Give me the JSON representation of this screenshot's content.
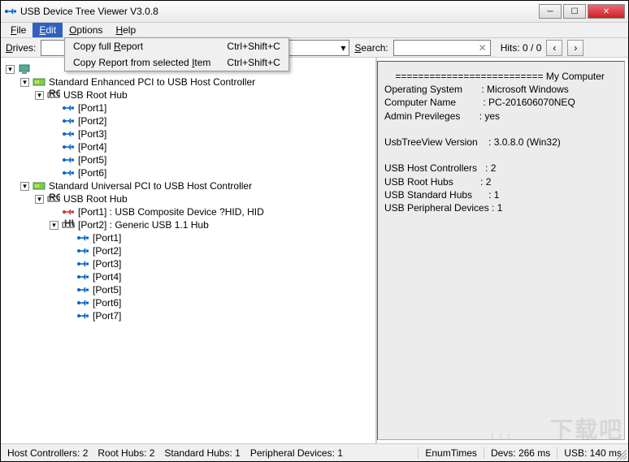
{
  "title": "USB Device Tree Viewer V3.0.8",
  "menubar": [
    "File",
    "Edit",
    "Options",
    "Help"
  ],
  "active_menu": "Edit",
  "dropdown": [
    {
      "label": "Copy full Report",
      "shortcut": "Ctrl+Shift+C",
      "u": "R"
    },
    {
      "label": "Copy Report from selected Item",
      "shortcut": "Ctrl+Shift+C",
      "u": "I"
    }
  ],
  "toolbar": {
    "drives_label": "Drives:",
    "search_label": "Search:",
    "hits_label": "Hits: 0 / 0"
  },
  "tree": [
    {
      "indent": 0,
      "expander": "-",
      "icon": "computer",
      "label": ""
    },
    {
      "indent": 1,
      "expander": "-",
      "icon": "controller",
      "label": "Standard Enhanced PCI to USB Host Controller"
    },
    {
      "indent": 2,
      "expander": "-",
      "icon": "roothub",
      "label": "USB Root Hub"
    },
    {
      "indent": 3,
      "expander": "",
      "icon": "usb",
      "label": "[Port1]"
    },
    {
      "indent": 3,
      "expander": "",
      "icon": "usb",
      "label": "[Port2]"
    },
    {
      "indent": 3,
      "expander": "",
      "icon": "usb",
      "label": "[Port3]"
    },
    {
      "indent": 3,
      "expander": "",
      "icon": "usb",
      "label": "[Port4]"
    },
    {
      "indent": 3,
      "expander": "",
      "icon": "usb",
      "label": "[Port5]"
    },
    {
      "indent": 3,
      "expander": "",
      "icon": "usb",
      "label": "[Port6]"
    },
    {
      "indent": 1,
      "expander": "-",
      "icon": "controller",
      "label": "Standard Universal PCI to USB Host Controller"
    },
    {
      "indent": 2,
      "expander": "-",
      "icon": "roothub",
      "label": "USB Root Hub"
    },
    {
      "indent": 3,
      "expander": "",
      "icon": "composite",
      "label": "[Port1] : USB Composite Device ?HID, HID"
    },
    {
      "indent": 3,
      "expander": "-",
      "icon": "hub",
      "label": "[Port2] : Generic USB 1.1 Hub"
    },
    {
      "indent": 4,
      "expander": "",
      "icon": "usb",
      "label": "[Port1]"
    },
    {
      "indent": 4,
      "expander": "",
      "icon": "usb",
      "label": "[Port2]"
    },
    {
      "indent": 4,
      "expander": "",
      "icon": "usb",
      "label": "[Port3]"
    },
    {
      "indent": 4,
      "expander": "",
      "icon": "usb",
      "label": "[Port4]"
    },
    {
      "indent": 4,
      "expander": "",
      "icon": "usb",
      "label": "[Port5]"
    },
    {
      "indent": 4,
      "expander": "",
      "icon": "usb",
      "label": "[Port6]"
    },
    {
      "indent": 4,
      "expander": "",
      "icon": "usb",
      "label": "[Port7]"
    }
  ],
  "info_lines": [
    "    ========================== My Computer",
    "Operating System       : Microsoft Windows",
    "Computer Name          : PC-201606070NEQ",
    "Admin Previleges       : yes",
    "",
    "UsbTreeView Version    : 3.0.8.0 (Win32)",
    "",
    "USB Host Controllers   : 2",
    "USB Root Hubs          : 2",
    "USB Standard Hubs      : 1",
    "USB Peripheral Devices : 1"
  ],
  "statusbar": {
    "host_controllers": "Host Controllers: 2",
    "root_hubs": "Root Hubs: 2",
    "standard_hubs": "Standard Hubs: 1",
    "peripheral": "Peripheral Devices: 1",
    "enum": "EnumTimes",
    "devs": "Devs: 266 ms",
    "usb": "USB: 140 ms"
  },
  "watermark": "下载吧"
}
